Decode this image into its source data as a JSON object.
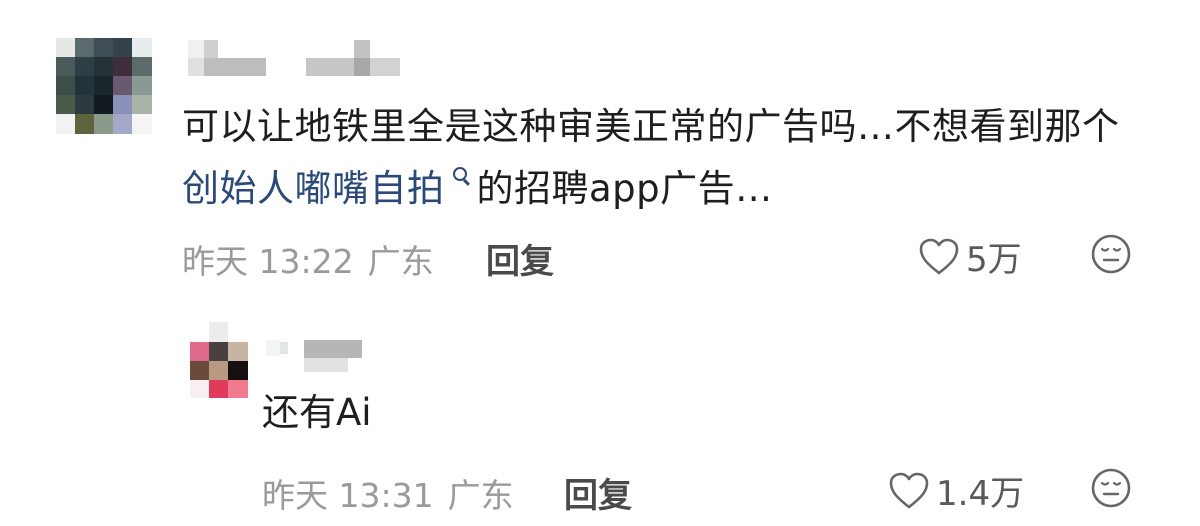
{
  "comments": [
    {
      "text_prefix": "可以让地铁里全是这种审美正常的广告吗…不想看到那个 ",
      "link_text": "创始人嘟嘴自拍",
      "text_suffix": "的招聘app广告…",
      "time": "昨天 13:22",
      "location": "广东",
      "reply_label": "回复",
      "likes": "5万",
      "icons": {
        "like": "heart-icon",
        "react": "neutral-face-icon",
        "link": "search-icon"
      }
    },
    {
      "text": "还有Ai",
      "time": "昨天 13:31",
      "location": "广东",
      "reply_label": "回复",
      "likes": "1.4万",
      "icons": {
        "like": "heart-icon",
        "react": "neutral-face-icon"
      }
    }
  ],
  "colors": {
    "link": "#2b4a7a",
    "meta": "#9a9a9a",
    "text": "#1e1e1e"
  }
}
